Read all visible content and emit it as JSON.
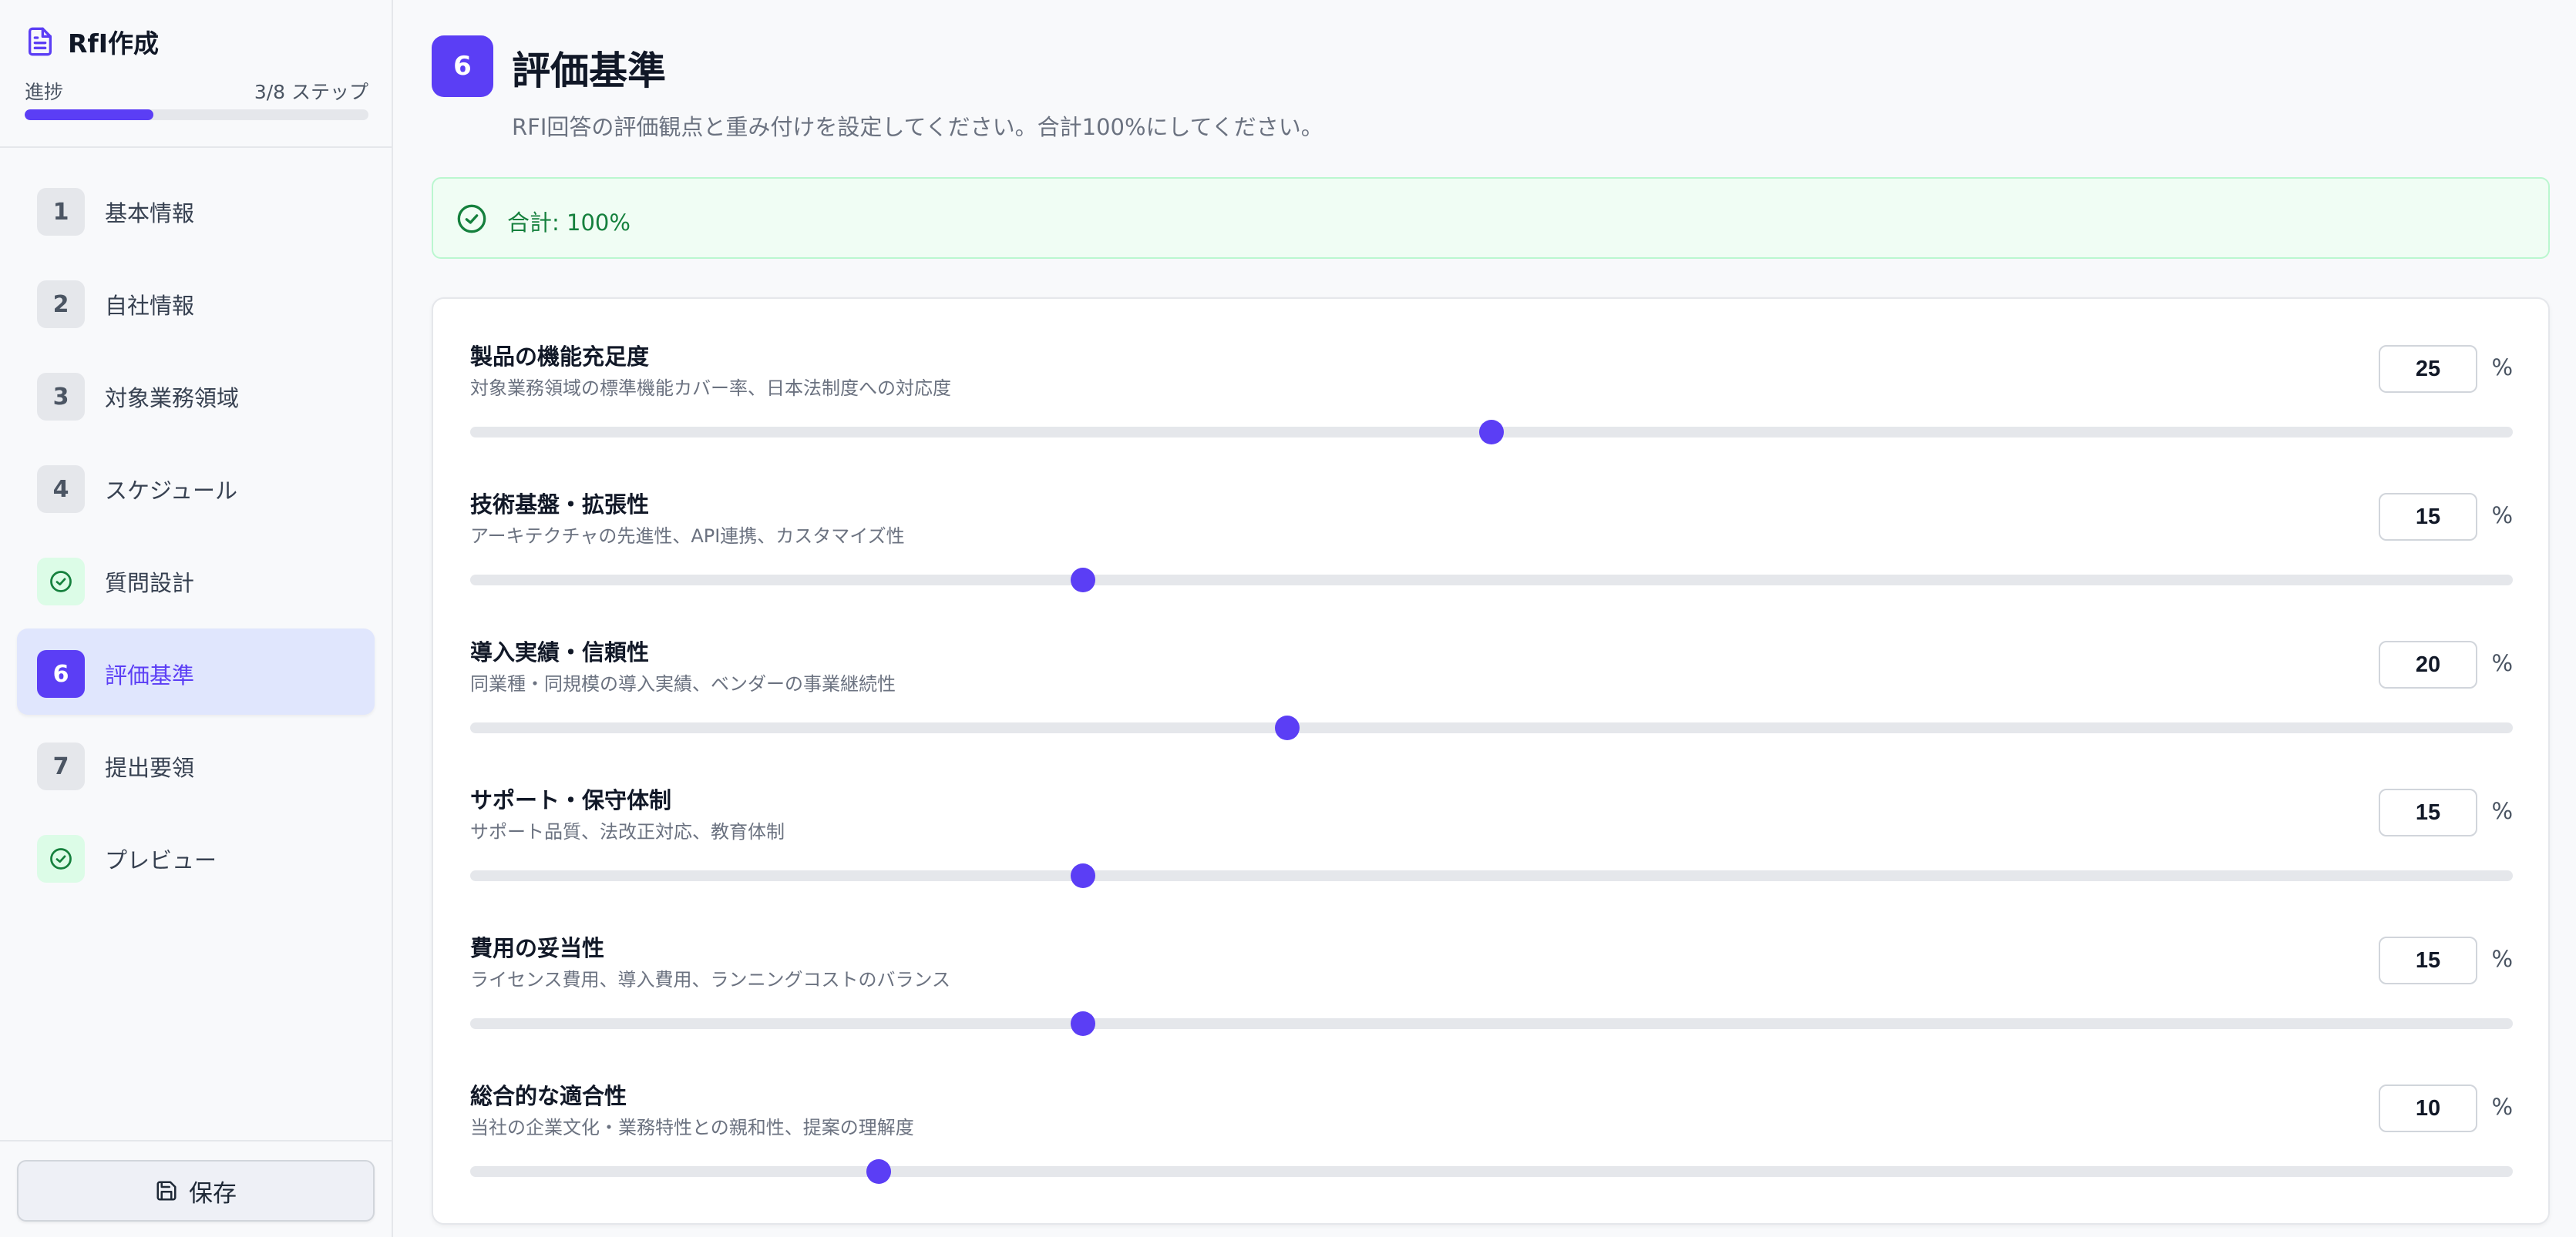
{
  "app": {
    "title": "RfI作成"
  },
  "progress": {
    "label": "進捗",
    "steps_text": "3/8 ステップ",
    "fraction": 0.375
  },
  "nav": [
    {
      "badge": "1",
      "label": "基本情報",
      "state": "todo"
    },
    {
      "badge": "2",
      "label": "自社情報",
      "state": "todo"
    },
    {
      "badge": "3",
      "label": "対象業務領域",
      "state": "todo"
    },
    {
      "badge": "4",
      "label": "スケジュール",
      "state": "todo"
    },
    {
      "badge": "",
      "label": "質問設計",
      "state": "done",
      "icon": "check-circle-icon"
    },
    {
      "badge": "6",
      "label": "評価基準",
      "state": "current"
    },
    {
      "badge": "7",
      "label": "提出要領",
      "state": "todo"
    },
    {
      "badge": "",
      "label": "プレビュー",
      "state": "done",
      "icon": "check-circle-icon"
    }
  ],
  "save": {
    "label": "保存",
    "icon": "save-icon"
  },
  "page": {
    "step": "6",
    "title": "評価基準",
    "description": "RFI回答の評価観点と重み付けを設定してください。合計100%にしてください。"
  },
  "total": {
    "text": "合計: 100%",
    "icon": "check-circle-icon"
  },
  "criteria": [
    {
      "name": "製品の機能充足度",
      "desc": "対象業務領域の標準機能カバー率、日本法制度への対応度",
      "value": "25",
      "unit": "%",
      "slider_fraction": 0.5
    },
    {
      "name": "技術基盤・拡張性",
      "desc": "アーキテクチャの先進性、API連携、カスタマイズ性",
      "value": "15",
      "unit": "%",
      "slider_fraction": 0.3
    },
    {
      "name": "導入実績・信頼性",
      "desc": "同業種・同規模の導入実績、ベンダーの事業継続性",
      "value": "20",
      "unit": "%",
      "slider_fraction": 0.4
    },
    {
      "name": "サポート・保守体制",
      "desc": "サポート品質、法改正対応、教育体制",
      "value": "15",
      "unit": "%",
      "slider_fraction": 0.3
    },
    {
      "name": "費用の妥当性",
      "desc": "ライセンス費用、導入費用、ランニングコストのバランス",
      "value": "15",
      "unit": "%",
      "slider_fraction": 0.3
    },
    {
      "name": "総合的な適合性",
      "desc": "当社の企業文化・業務特性との親和性、提案の理解度",
      "value": "10",
      "unit": "%",
      "slider_fraction": 0.2
    }
  ],
  "colors": {
    "accent": "#5b3ef5",
    "success": "#15803d",
    "success_bg": "#f0fdf4",
    "active_bg": "#e0e6fd"
  }
}
